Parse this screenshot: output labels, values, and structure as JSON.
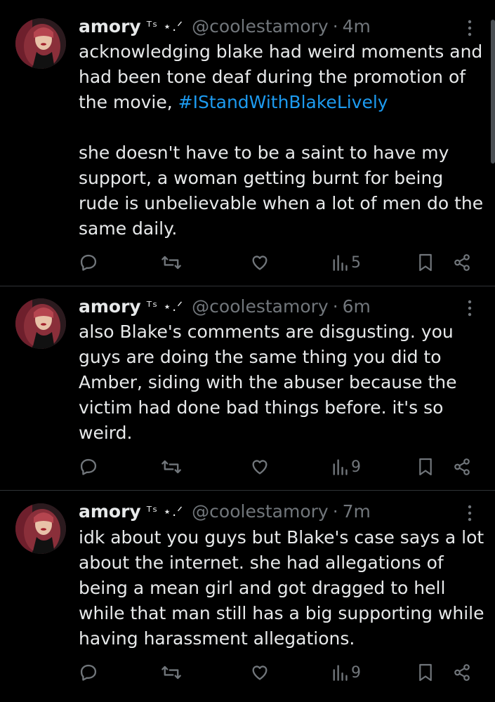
{
  "tweets": [
    {
      "author": {
        "display_name": "amory",
        "name_decoration": "ᵀˢ ⋆.ᐟ",
        "handle": "@coolestamory"
      },
      "time": "4m",
      "text_before_hashtag": "acknowledging blake had weird moments and had been tone deaf during the promotion of the movie, ",
      "hashtag": "#IStandWithBlakeLively",
      "text_after_hashtag": "\n\nshe doesn't have to be a saint to have my support, a woman getting burnt for being rude is unbelievable when a lot of men do the same daily.",
      "views": "5"
    },
    {
      "author": {
        "display_name": "amory",
        "name_decoration": "ᵀˢ ⋆.ᐟ",
        "handle": "@coolestamory"
      },
      "time": "6m",
      "text": "also Blake's comments are disgusting. you guys are doing the same thing you did to Amber, siding with the abuser because the victim had done bad things before. it's so weird.",
      "views": "9"
    },
    {
      "author": {
        "display_name": "amory",
        "name_decoration": "ᵀˢ ⋆.ᐟ",
        "handle": "@coolestamory"
      },
      "time": "7m",
      "text": "idk about you guys but Blake's case says a lot about the internet. she had allegations of being a mean girl and got dragged to hell while that man still has a big supporting while having harassment allegations.",
      "views": "9"
    }
  ],
  "separator": "·",
  "icons": {
    "more": "more-vertical-icon",
    "reply": "reply-icon",
    "repost": "repost-icon",
    "like": "heart-icon",
    "views": "views-icon",
    "bookmark": "bookmark-icon",
    "share": "share-icon"
  },
  "colors": {
    "background": "#000000",
    "text": "#e7e9ea",
    "secondary": "#71767b",
    "hashtag": "#1d9bf0",
    "divider": "#2f3336"
  }
}
